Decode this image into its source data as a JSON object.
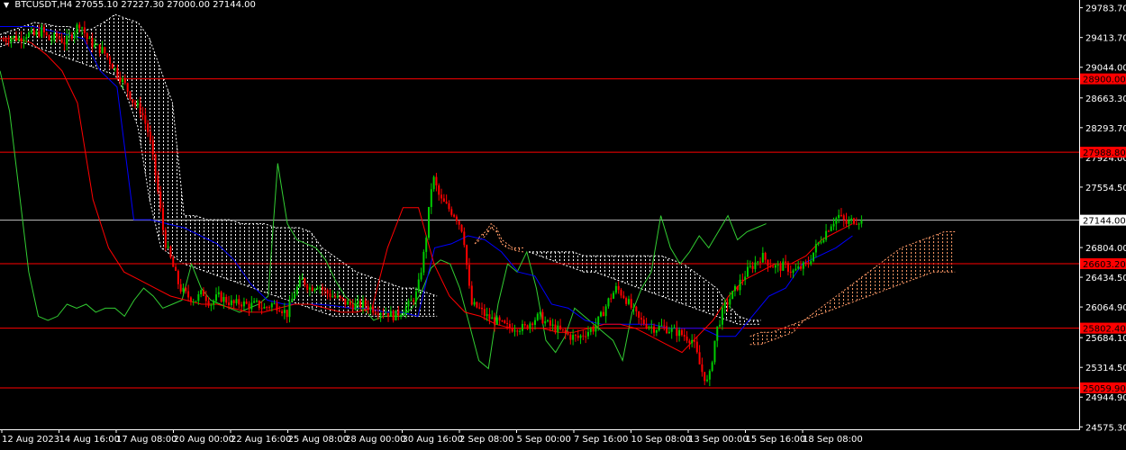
{
  "header": {
    "menu_icon": "triangle-down-icon",
    "symbol": "BTCUSDT,H4",
    "open": "27055.10",
    "high": "27227.30",
    "low": "27000.00",
    "close": "27144.00"
  },
  "colors": {
    "background": "#000000",
    "frame": "#ffffff",
    "bull_candle": "#00cc00",
    "bear_candle": "#ff0000",
    "level_line": "#ff0000",
    "level_label_bg": "#ff0000",
    "current_price_line": "#c0c0c0",
    "current_price_label_bg": "#ffffff",
    "kijun": "#0000ff",
    "tenkan": "#ff0000",
    "chikou": "#32cd32",
    "cloud_up": "#ffffff",
    "cloud_down": "#ff9966"
  },
  "chart_data": {
    "type": "candlestick",
    "indicator": "Ichimoku",
    "ylim": [
      24545,
      29880
    ],
    "yticks": [
      {
        "value": 29783.7,
        "label": "29783.70"
      },
      {
        "value": 29413.7,
        "label": "29413.70"
      },
      {
        "value": 29044.0,
        "label": "29044.00"
      },
      {
        "value": 28663.3,
        "label": "28663.30"
      },
      {
        "value": 28293.7,
        "label": "28293.70"
      },
      {
        "value": 27924.0,
        "label": "27924.00"
      },
      {
        "value": 27554.5,
        "label": "27554.50"
      },
      {
        "value": 26804.0,
        "label": "26804.00"
      },
      {
        "value": 26434.5,
        "label": "26434.50"
      },
      {
        "value": 26064.9,
        "label": "26064.90"
      },
      {
        "value": 25684.1,
        "label": "25684.10"
      },
      {
        "value": 25314.5,
        "label": "25314.50"
      },
      {
        "value": 24944.9,
        "label": "24944.90"
      },
      {
        "value": 24575.3,
        "label": "24575.30"
      }
    ],
    "levels": [
      {
        "value": 28900.0,
        "label": "28900.00"
      },
      {
        "value": 27988.8,
        "label": "27988.80"
      },
      {
        "value": 26603.2,
        "label": "26603.20"
      },
      {
        "value": 25802.4,
        "label": "25802.40"
      },
      {
        "value": 25059.9,
        "label": "25059.90"
      }
    ],
    "current_price": {
      "value": 27144.0,
      "label": "27144.00"
    },
    "xticks": [
      "12 Aug 2023",
      "14 Aug 16:00",
      "17 Aug 08:00",
      "20 Aug 00:00",
      "22 Aug 16:00",
      "25 Aug 08:00",
      "28 Aug 00:00",
      "30 Aug 16:00",
      "2 Sep 08:00",
      "5 Sep 00:00",
      "7 Sep 16:00",
      "10 Sep 08:00",
      "13 Sep 00:00",
      "15 Sep 16:00",
      "18 Sep 08:00"
    ],
    "price_path": [
      29380,
      29420,
      29400,
      29460,
      29440,
      29500,
      29380,
      29430,
      29350,
      29470,
      29600,
      29380,
      29300,
      29250,
      29100,
      28950,
      28800,
      28600,
      28500,
      28200,
      27600,
      26900,
      26600,
      26300,
      26200,
      26150,
      26250,
      26100,
      26200,
      26150,
      26100,
      26120,
      26080,
      26100,
      26050,
      26100,
      26070,
      25980,
      26250,
      26400,
      26300,
      26350,
      26250,
      26200,
      26150,
      26100,
      26080,
      26100,
      26050,
      26020,
      26000,
      25950,
      26020,
      26100,
      26250,
      26800,
      27700,
      27400,
      27300,
      27200,
      27000,
      26100,
      26050,
      25950,
      25900,
      25850,
      25800,
      25820,
      25800,
      25900,
      25950,
      25850,
      25800,
      25750,
      25700,
      25680,
      25750,
      25800,
      25950,
      26150,
      26300,
      26200,
      26050,
      25900,
      25850,
      25800,
      25820,
      25780,
      25750,
      25700,
      25650,
      25300,
      25100,
      25750,
      26050,
      26200,
      26350,
      26500,
      26600,
      26700,
      26600,
      26550,
      26580,
      26500,
      26550,
      26600,
      26800,
      26950,
      27100,
      27200,
      27100,
      27150,
      27144
    ],
    "kijun": [
      29550,
      29550,
      29550,
      29500,
      29450,
      29400,
      29000,
      28800,
      27150,
      27150,
      27100,
      27050,
      26950,
      26850,
      26650,
      26350,
      26150,
      26100,
      26100,
      26100,
      26080,
      26050,
      26050,
      26000,
      26000,
      25950,
      26800,
      26850,
      26950,
      26900,
      26750,
      26500,
      26450,
      26100,
      26050,
      25900,
      25850,
      25850,
      25850,
      25850,
      25800,
      25800,
      25800,
      25700,
      25700,
      25950,
      26200,
      26300,
      26600,
      26700,
      26800,
      26950
    ],
    "tenkan": [
      29400,
      29400,
      29350,
      29200,
      29000,
      28600,
      27400,
      26800,
      26500,
      26400,
      26300,
      26200,
      26150,
      26100,
      26100,
      26050,
      26000,
      26000,
      26050,
      26100,
      26100,
      26050,
      26000,
      26000,
      26050,
      26800,
      27300,
      27300,
      26600,
      26200,
      26000,
      25950,
      25850,
      25800,
      25800,
      25800,
      25750,
      25750,
      25800,
      25850,
      25850,
      25800,
      25700,
      25600,
      25500,
      25700,
      25900,
      26200,
      26400,
      26500,
      26600,
      26600,
      26700,
      26900,
      27000,
      27100
    ],
    "chikou": [
      29000,
      28500,
      27500,
      26500,
      25950,
      25900,
      25950,
      26100,
      26050,
      26100,
      26000,
      26050,
      26050,
      25950,
      26150,
      26300,
      26200,
      26050,
      26100,
      26150,
      26600,
      26300,
      26150,
      26100,
      26050,
      26000,
      26050,
      26100,
      26200,
      27850,
      27100,
      26900,
      26850,
      26800,
      26650,
      26400,
      26200,
      26100,
      26050,
      25900,
      25950,
      25950,
      25950,
      26050,
      26250,
      26550,
      26650,
      26600,
      26300,
      25850,
      25400,
      25300,
      26100,
      26600,
      26500,
      26750,
      26300,
      25650,
      25500,
      25700,
      26050,
      25950,
      25850,
      25750,
      25650,
      25400,
      26000,
      26300,
      26500,
      27200,
      26800,
      26600,
      26750,
      26950,
      26800,
      27000,
      27200,
      26900,
      27000,
      27050,
      27100
    ],
    "cloud_up_segment": {
      "a": [
        29450,
        29500,
        29550,
        29600,
        29580,
        29550,
        29550,
        29500,
        29520,
        29600,
        29700,
        29650,
        29600,
        29400,
        29000,
        28600,
        27200,
        27200,
        27150,
        27150,
        27150,
        27100,
        27100,
        27100,
        27050,
        27050,
        27050,
        27000,
        26800,
        26700,
        26600,
        26500,
        26450,
        26400,
        26350,
        26300,
        26300,
        26250,
        26200
      ],
      "b": [
        29300,
        29350,
        29350,
        29300,
        29250,
        29200,
        29150,
        29100,
        29050,
        29000,
        28950,
        28700,
        28300,
        27400,
        26800,
        26700,
        26600,
        26550,
        26500,
        26450,
        26400,
        26350,
        26300,
        26250,
        26200,
        26150,
        26100,
        26050,
        26000,
        25950,
        25950,
        25950,
        25950,
        25950,
        25950,
        25950,
        25950,
        25950,
        25950
      ]
    },
    "cloud_down_segment": {
      "a": [
        26850,
        26950,
        27000,
        27100,
        27050,
        26900,
        26850,
        26800,
        26800,
        26800
      ],
      "b": [
        26850,
        26900,
        26950,
        27050,
        27000,
        26850,
        26800,
        26780,
        26760,
        26750
      ]
    },
    "cloud_late_segment": {
      "a": [
        26750,
        26750,
        26750,
        26750,
        26750,
        26700,
        26700,
        26700,
        26700,
        26700,
        26700,
        26700,
        26700,
        26650,
        26600,
        26500,
        26400,
        26300,
        26100,
        25950,
        25900,
        25900
      ],
      "b": [
        26750,
        26700,
        26650,
        26600,
        26550,
        26500,
        26500,
        26450,
        26400,
        26350,
        26300,
        26250,
        26200,
        26150,
        26100,
        26050,
        26000,
        25950,
        25900,
        25850,
        25850,
        25850
      ]
    },
    "cloud_future_segment": {
      "a": [
        25600,
        25600,
        25650,
        25700,
        25750,
        25900,
        26000,
        26100,
        26200,
        26300,
        26400,
        26500,
        26600,
        26700,
        26800,
        26850,
        26900,
        26950,
        27000,
        27000
      ],
      "b": [
        25700,
        25750,
        25750,
        25800,
        25850,
        25900,
        25950,
        26000,
        26050,
        26100,
        26150,
        26200,
        26250,
        26300,
        26350,
        26400,
        26450,
        26500,
        26500,
        26500
      ]
    }
  }
}
